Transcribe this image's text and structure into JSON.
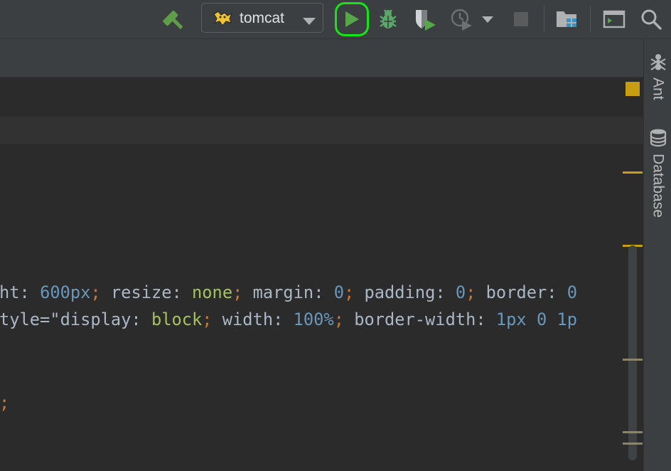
{
  "toolbar": {
    "run_configuration": {
      "name": "tomcat",
      "icon": "tomcat-icon"
    },
    "buttons": [
      {
        "name": "build",
        "icon": "hammer-icon"
      },
      {
        "name": "run",
        "icon": "run-icon",
        "highlighted": true
      },
      {
        "name": "debug",
        "icon": "bug-icon"
      },
      {
        "name": "run-with-coverage",
        "icon": "coverage-icon"
      },
      {
        "name": "profile",
        "icon": "profiler-icon"
      },
      {
        "name": "stop",
        "icon": "stop-icon"
      },
      {
        "name": "project-structure",
        "icon": "project-structure-icon"
      },
      {
        "name": "terminal",
        "icon": "terminal-icon"
      },
      {
        "name": "search-everywhere",
        "icon": "search-icon"
      }
    ],
    "highlight_color": "#14e614"
  },
  "editor": {
    "lines": [
      {
        "tokens": [
          {
            "text": "ht",
            "kind": "prop"
          },
          {
            "text": ": ",
            "kind": "str"
          },
          {
            "text": "600",
            "kind": "num"
          },
          {
            "text": "px",
            "kind": "unit"
          },
          {
            "text": "; ",
            "kind": "punc"
          },
          {
            "text": "resize",
            "kind": "prop"
          },
          {
            "text": ": ",
            "kind": "str"
          },
          {
            "text": "none",
            "kind": "kw"
          },
          {
            "text": "; ",
            "kind": "punc"
          },
          {
            "text": "margin",
            "kind": "prop"
          },
          {
            "text": ": ",
            "kind": "str"
          },
          {
            "text": "0",
            "kind": "num"
          },
          {
            "text": "; ",
            "kind": "punc"
          },
          {
            "text": "padding",
            "kind": "prop"
          },
          {
            "text": ": ",
            "kind": "str"
          },
          {
            "text": "0",
            "kind": "num"
          },
          {
            "text": "; ",
            "kind": "punc"
          },
          {
            "text": "border",
            "kind": "prop"
          },
          {
            "text": ": ",
            "kind": "str"
          },
          {
            "text": "0",
            "kind": "num"
          }
        ]
      },
      {
        "tokens": [
          {
            "text": "tyle=\"",
            "kind": "str"
          },
          {
            "text": "display",
            "kind": "prop"
          },
          {
            "text": ": ",
            "kind": "str"
          },
          {
            "text": "block",
            "kind": "kw"
          },
          {
            "text": "; ",
            "kind": "punc"
          },
          {
            "text": "width",
            "kind": "prop"
          },
          {
            "text": ": ",
            "kind": "str"
          },
          {
            "text": "100",
            "kind": "num"
          },
          {
            "text": "%",
            "kind": "unit"
          },
          {
            "text": "; ",
            "kind": "punc"
          },
          {
            "text": "border-width",
            "kind": "prop"
          },
          {
            "text": ": ",
            "kind": "str"
          },
          {
            "text": "1",
            "kind": "num"
          },
          {
            "text": "px",
            "kind": "unit"
          },
          {
            "text": " ",
            "kind": "str"
          },
          {
            "text": "0",
            "kind": "num"
          },
          {
            "text": " ",
            "kind": "str"
          },
          {
            "text": "1p",
            "kind": "num"
          }
        ]
      },
      {
        "tokens": [
          {
            "text": ";",
            "kind": "punc"
          }
        ]
      }
    ],
    "colors": {
      "background": "#2b2b2b",
      "number": "#6897bb",
      "keyword": "#a5c25c",
      "punctuation": "#cc7832",
      "property": "#a9b7c6",
      "warning_marker": "#c89d12"
    }
  },
  "right_tool_strip": {
    "tabs": [
      {
        "label": "Ant",
        "icon": "ant-icon"
      },
      {
        "label": "Database",
        "icon": "database-icon"
      }
    ]
  }
}
